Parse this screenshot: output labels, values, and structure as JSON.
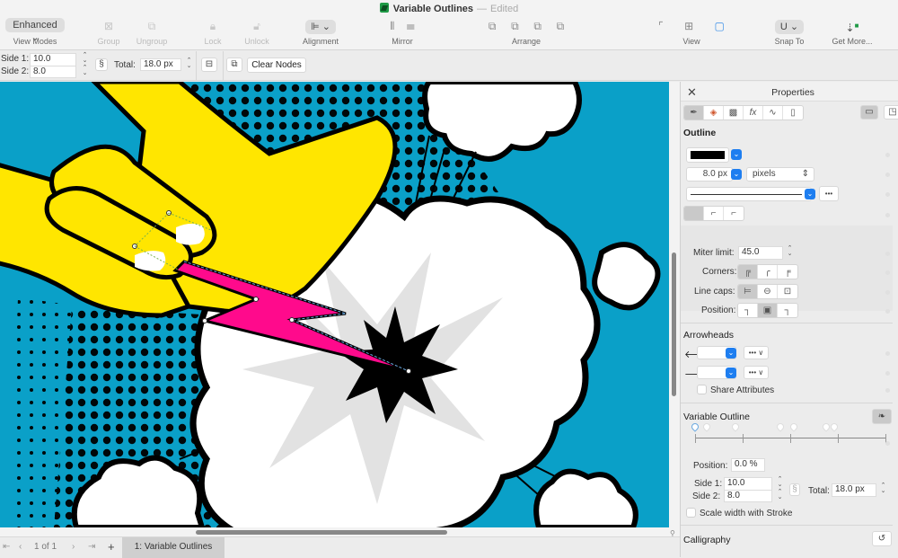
{
  "window": {
    "title": "Variable Outlines",
    "status": "Edited"
  },
  "toolbar": {
    "view_mode": "Enhanced",
    "items": [
      {
        "label": "View Modes",
        "icon": "view-mode-icon"
      },
      {
        "label": "Group",
        "icon": "group-icon"
      },
      {
        "label": "Ungroup",
        "icon": "ungroup-icon"
      },
      {
        "label": "Lock",
        "icon": "lock-icon"
      },
      {
        "label": "Unlock",
        "icon": "unlock-icon"
      },
      {
        "label": "Alignment",
        "icon": "alignment-icon"
      },
      {
        "label": "Mirror",
        "icon": "mirror-icon"
      },
      {
        "label": "Arrange",
        "icon": "arrange-icon"
      },
      {
        "label": "View",
        "icon": "view-icon"
      },
      {
        "label": "Snap To",
        "icon": "magnet-icon"
      },
      {
        "label": "Get More...",
        "icon": "get-more-icon"
      }
    ]
  },
  "propbar": {
    "side1_label": "Side 1:",
    "side1_value": "10.0",
    "side2_label": "Side 2:",
    "side2_value": "8.0",
    "total_label": "Total:",
    "total_value": "18.0 px",
    "clear_nodes": "Clear Nodes"
  },
  "footer": {
    "page_indicator": "1 of 1",
    "add": "+",
    "page_tab": "1: Variable Outlines"
  },
  "panel": {
    "title": "Properties",
    "outline": {
      "title": "Outline",
      "color": "#000000",
      "width": "8.0 px",
      "unit": "pixels",
      "more": "•••",
      "miter_label": "Miter limit:",
      "miter_value": "45.0",
      "corners_label": "Corners:",
      "linecaps_label": "Line caps:",
      "position_label": "Position:"
    },
    "arrowheads": {
      "title": "Arrowheads",
      "start_more": "••• ∨",
      "end_more": "••• ∨",
      "share_label": "Share Attributes",
      "share_checked": false
    },
    "variable_outline": {
      "title": "Variable Outline",
      "position_label": "Position:",
      "position_value": "0.0 %",
      "side1_label": "Side 1:",
      "side1_value": "10.0",
      "side2_label": "Side 2:",
      "side2_value": "8.0",
      "total_label": "Total:",
      "total_value": "18.0 px",
      "scale_label": "Scale width with Stroke",
      "scale_checked": false,
      "node_positions_pct": [
        0,
        6,
        21,
        45,
        52,
        69,
        73
      ]
    },
    "calligraphy": {
      "title": "Calligraphy"
    }
  },
  "colors": {
    "sky": "#0aa0c8",
    "hand": "#ffe600",
    "bolt": "#ff0a8c",
    "accent": "#1e7ef0"
  }
}
